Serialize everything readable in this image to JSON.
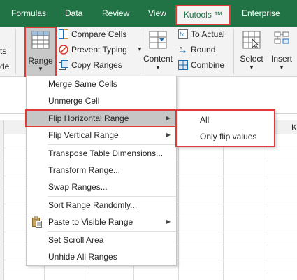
{
  "tabs": [
    {
      "label": "Formulas"
    },
    {
      "label": "Data"
    },
    {
      "label": "Review"
    },
    {
      "label": "View"
    },
    {
      "label": "Kutools ™"
    },
    {
      "label": "Enterprise"
    }
  ],
  "ribbon": {
    "left_fragments": [
      "ts",
      "de"
    ],
    "range_button": {
      "label": "Range"
    },
    "commands": [
      {
        "label": "Compare Cells",
        "icon": "compare-cells-icon"
      },
      {
        "label": "Prevent Typing",
        "icon": "prevent-typing-icon",
        "has_dropdown": true
      },
      {
        "label": "Copy Ranges",
        "icon": "copy-ranges-icon"
      }
    ],
    "content_button": {
      "label": "Content"
    },
    "content_commands": [
      {
        "label": "To Actual",
        "icon": "to-actual-icon"
      },
      {
        "label": "Round",
        "icon": "round-icon"
      },
      {
        "label": "Combine",
        "icon": "combine-icon"
      }
    ],
    "select_button": {
      "label": "Select"
    },
    "insert_button": {
      "label": "Insert"
    },
    "accent_color": "#217346",
    "highlight_color": "#e03a3a"
  },
  "col_header_fragment": "K",
  "menu": {
    "items": [
      {
        "label": "Merge Same Cells"
      },
      {
        "label": "Unmerge Cell"
      },
      {
        "label": "Flip Horizontal Range",
        "submenu": true,
        "highlighted": true
      },
      {
        "label": "Flip Vertical Range",
        "submenu": true
      },
      {
        "label": "Transpose Table Dimensions..."
      },
      {
        "label": "Transform Range..."
      },
      {
        "label": "Swap Ranges..."
      },
      {
        "label": "Sort Range Randomly..."
      },
      {
        "label": "Paste to Visible Range",
        "submenu": true,
        "icon": "paste-icon"
      },
      {
        "label": "Set Scroll Area"
      },
      {
        "label": "Unhide All Ranges"
      }
    ]
  },
  "submenu": {
    "items": [
      {
        "label": "All"
      },
      {
        "label": "Only flip values"
      }
    ]
  }
}
